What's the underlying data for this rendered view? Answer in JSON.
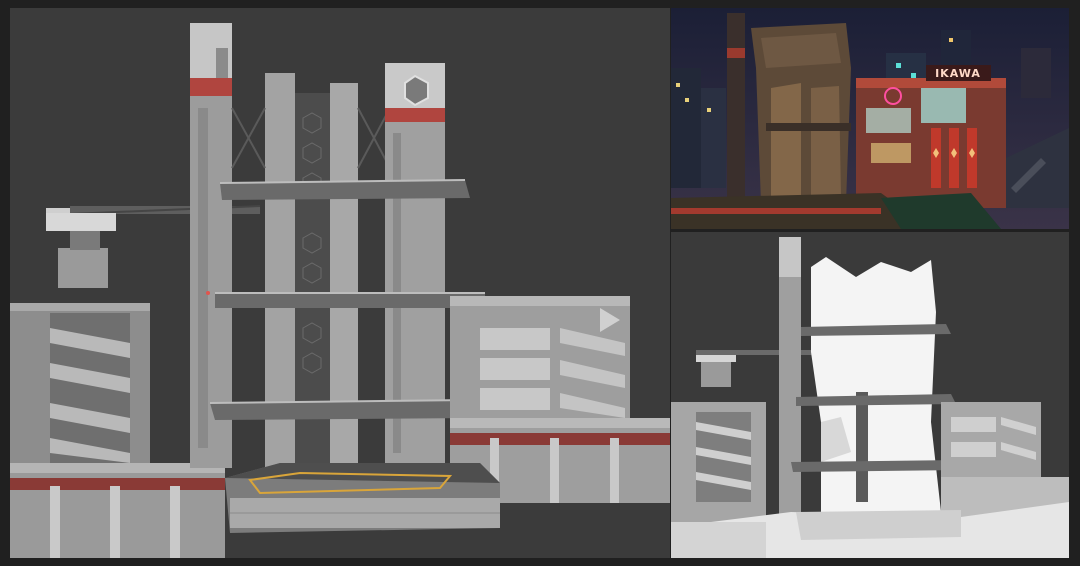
{
  "night_render": {
    "sign_text": "IKAWA"
  }
}
